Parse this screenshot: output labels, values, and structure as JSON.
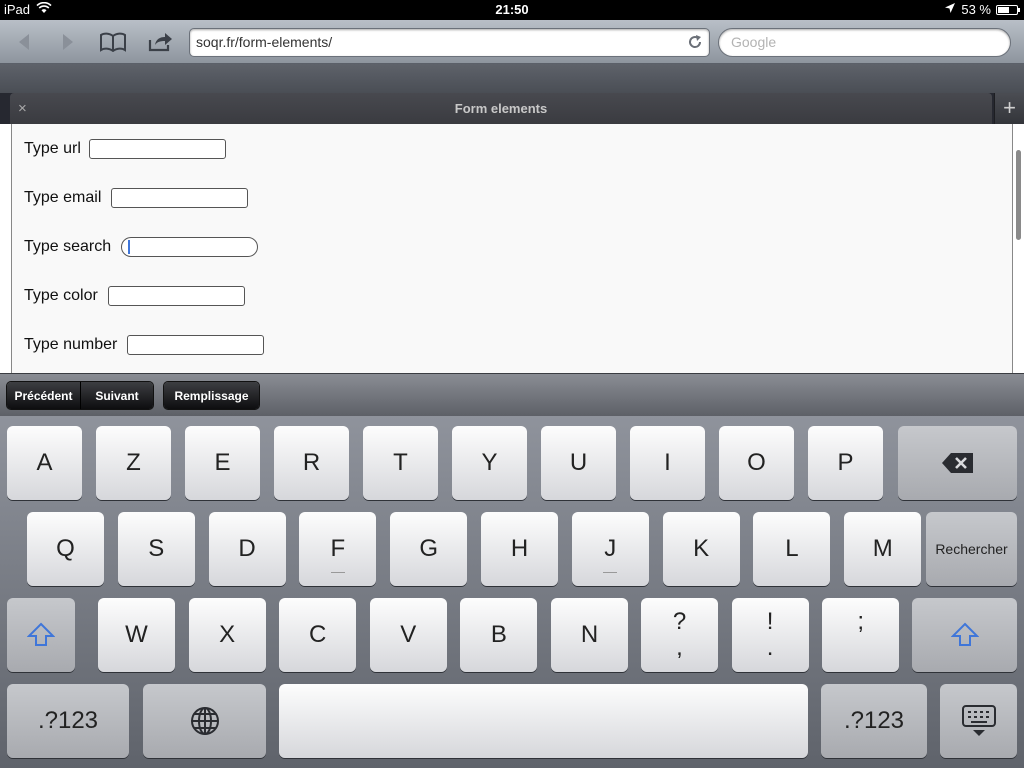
{
  "status_bar": {
    "device": "iPad",
    "time": "21:50",
    "battery_text": "53 %",
    "battery_level": 0.53
  },
  "toolbar": {
    "url": "soqr.fr/form-elements/",
    "search_placeholder": "Google"
  },
  "tab": {
    "title": "Form elements",
    "close_glyph": "×",
    "new_glyph": "+"
  },
  "form": {
    "rows": [
      {
        "label": "Type url"
      },
      {
        "label": "Type email"
      },
      {
        "label": "Type search"
      },
      {
        "label": "Type color"
      },
      {
        "label": "Type number"
      }
    ]
  },
  "assistant": {
    "previous": "Précédent",
    "next": "Suivant",
    "autofill": "Remplissage"
  },
  "keyboard": {
    "row1": [
      "A",
      "Z",
      "E",
      "R",
      "T",
      "Y",
      "U",
      "I",
      "O",
      "P"
    ],
    "row2": [
      "Q",
      "S",
      "D",
      "F",
      "G",
      "H",
      "J",
      "K",
      "L",
      "M"
    ],
    "search_key": "Rechercher",
    "row3": [
      "W",
      "X",
      "C",
      "V",
      "B",
      "N"
    ],
    "punct": [
      {
        "top": "?",
        "bottom": ","
      },
      {
        "top": "!",
        "bottom": "."
      },
      {
        "top": ";",
        "bottom": ""
      }
    ],
    "numbers_key": ".?123"
  },
  "colors": {
    "accent_blue": "#3f76d9",
    "keyboard_bg": "#7e828a"
  }
}
